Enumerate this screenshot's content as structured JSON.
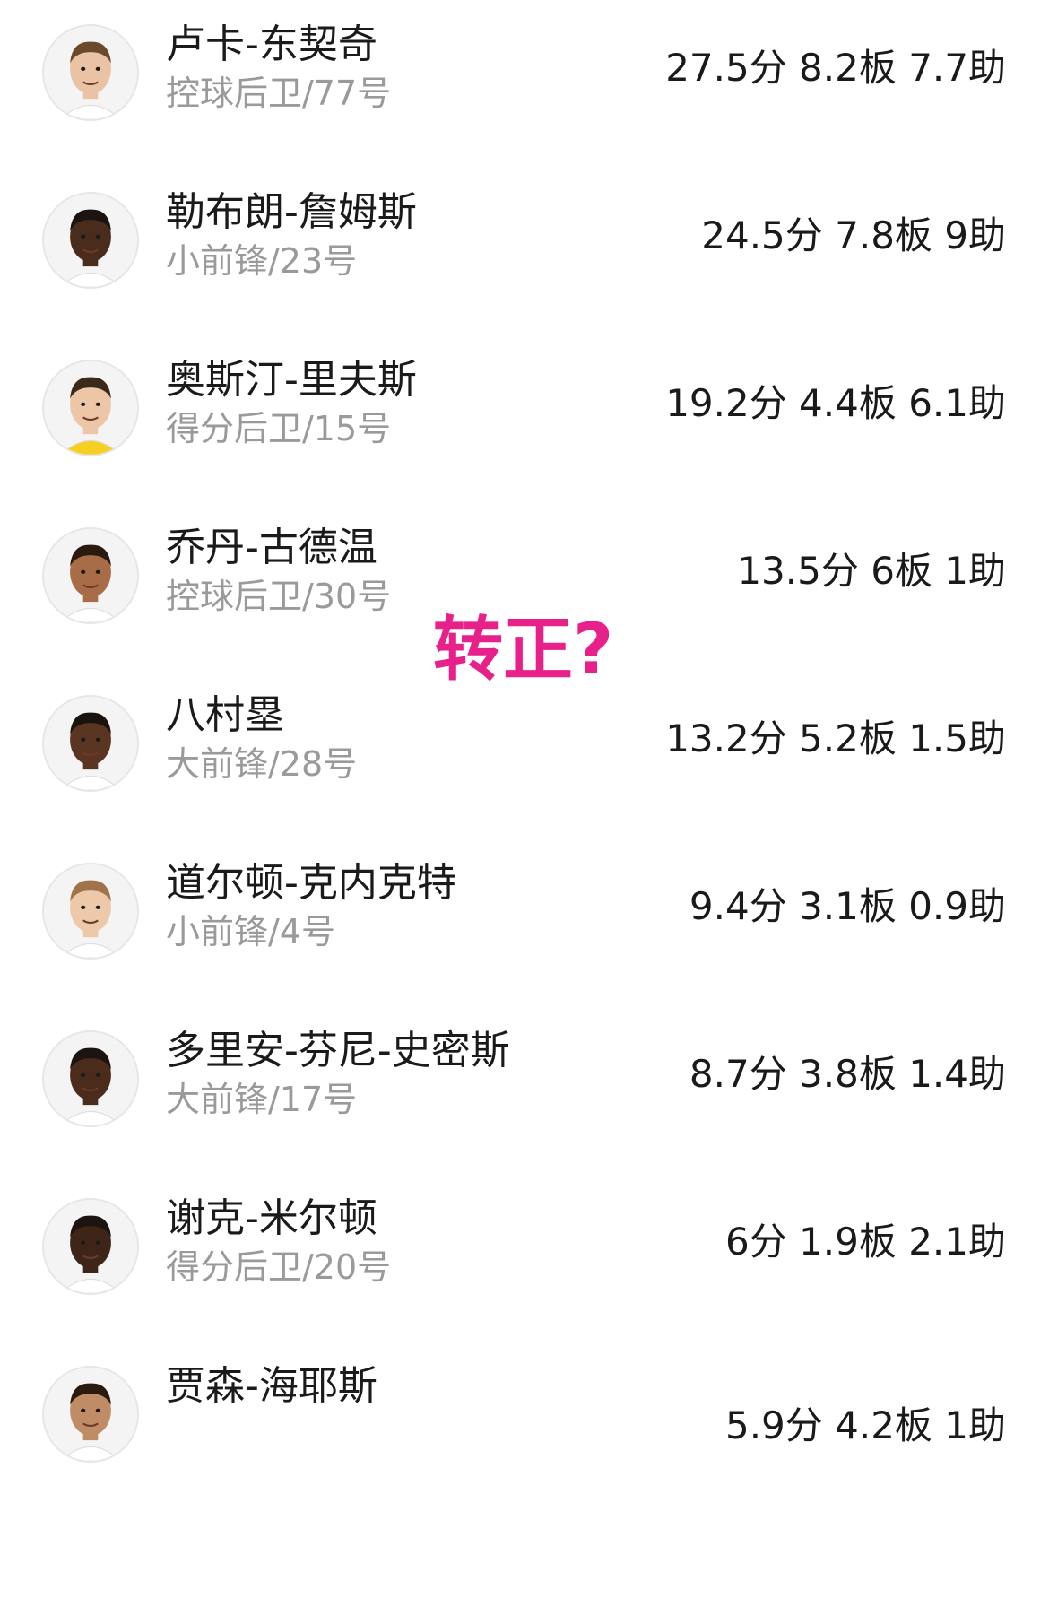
{
  "players": [
    {
      "name": "卢卡-东契奇",
      "position": "控球后卫/77号",
      "stats": "27.5分 8.2板 7.7助",
      "skin": "#e9c3a3",
      "hair": "#6b4a2b",
      "jersey": "#ffffff"
    },
    {
      "name": "勒布朗-詹姆斯",
      "position": "小前锋/23号",
      "stats": "24.5分 7.8板 9助",
      "skin": "#4a2c1c",
      "hair": "#1b1410",
      "jersey": "#ffffff"
    },
    {
      "name": "奥斯汀-里夫斯",
      "position": "得分后卫/15号",
      "stats": "19.2分 4.4板 6.1助",
      "skin": "#ecc6a6",
      "hair": "#3b2a1a",
      "jersey": "#f5d020"
    },
    {
      "name": "乔丹-古德温",
      "position": "控球后卫/30号",
      "stats": "13.5分 6板 1助",
      "skin": "#a86c46",
      "hair": "#2a1a10",
      "jersey": "#ffffff"
    },
    {
      "name": "八村塁",
      "position": "大前锋/28号",
      "stats": "13.2分 5.2板 1.5助",
      "skin": "#5a3522",
      "hair": "#1a120c",
      "jersey": "#ffffff"
    },
    {
      "name": "道尔顿-克内克特",
      "position": "小前锋/4号",
      "stats": "9.4分 3.1板 0.9助",
      "skin": "#eec9a9",
      "hair": "#a0734a",
      "jersey": "#ffffff"
    },
    {
      "name": "多里安-芬尼-史密斯",
      "position": "大前锋/17号",
      "stats": "8.7分 3.8板 1.4助",
      "skin": "#4b2c1c",
      "hair": "#1b1410",
      "jersey": "#ffffff"
    },
    {
      "name": "谢克-米尔顿",
      "position": "得分后卫/20号",
      "stats": "6分 1.9板 2.1助",
      "skin": "#3e2518",
      "hair": "#1b1410",
      "jersey": "#ffffff"
    },
    {
      "name": "贾森-海耶斯",
      "position": "",
      "stats": "5.9分 4.2板 1助",
      "skin": "#c08c66",
      "hair": "#2a1a10",
      "jersey": "#ffffff"
    }
  ],
  "annotation": {
    "text": "转正?",
    "color": "#e8218a"
  }
}
